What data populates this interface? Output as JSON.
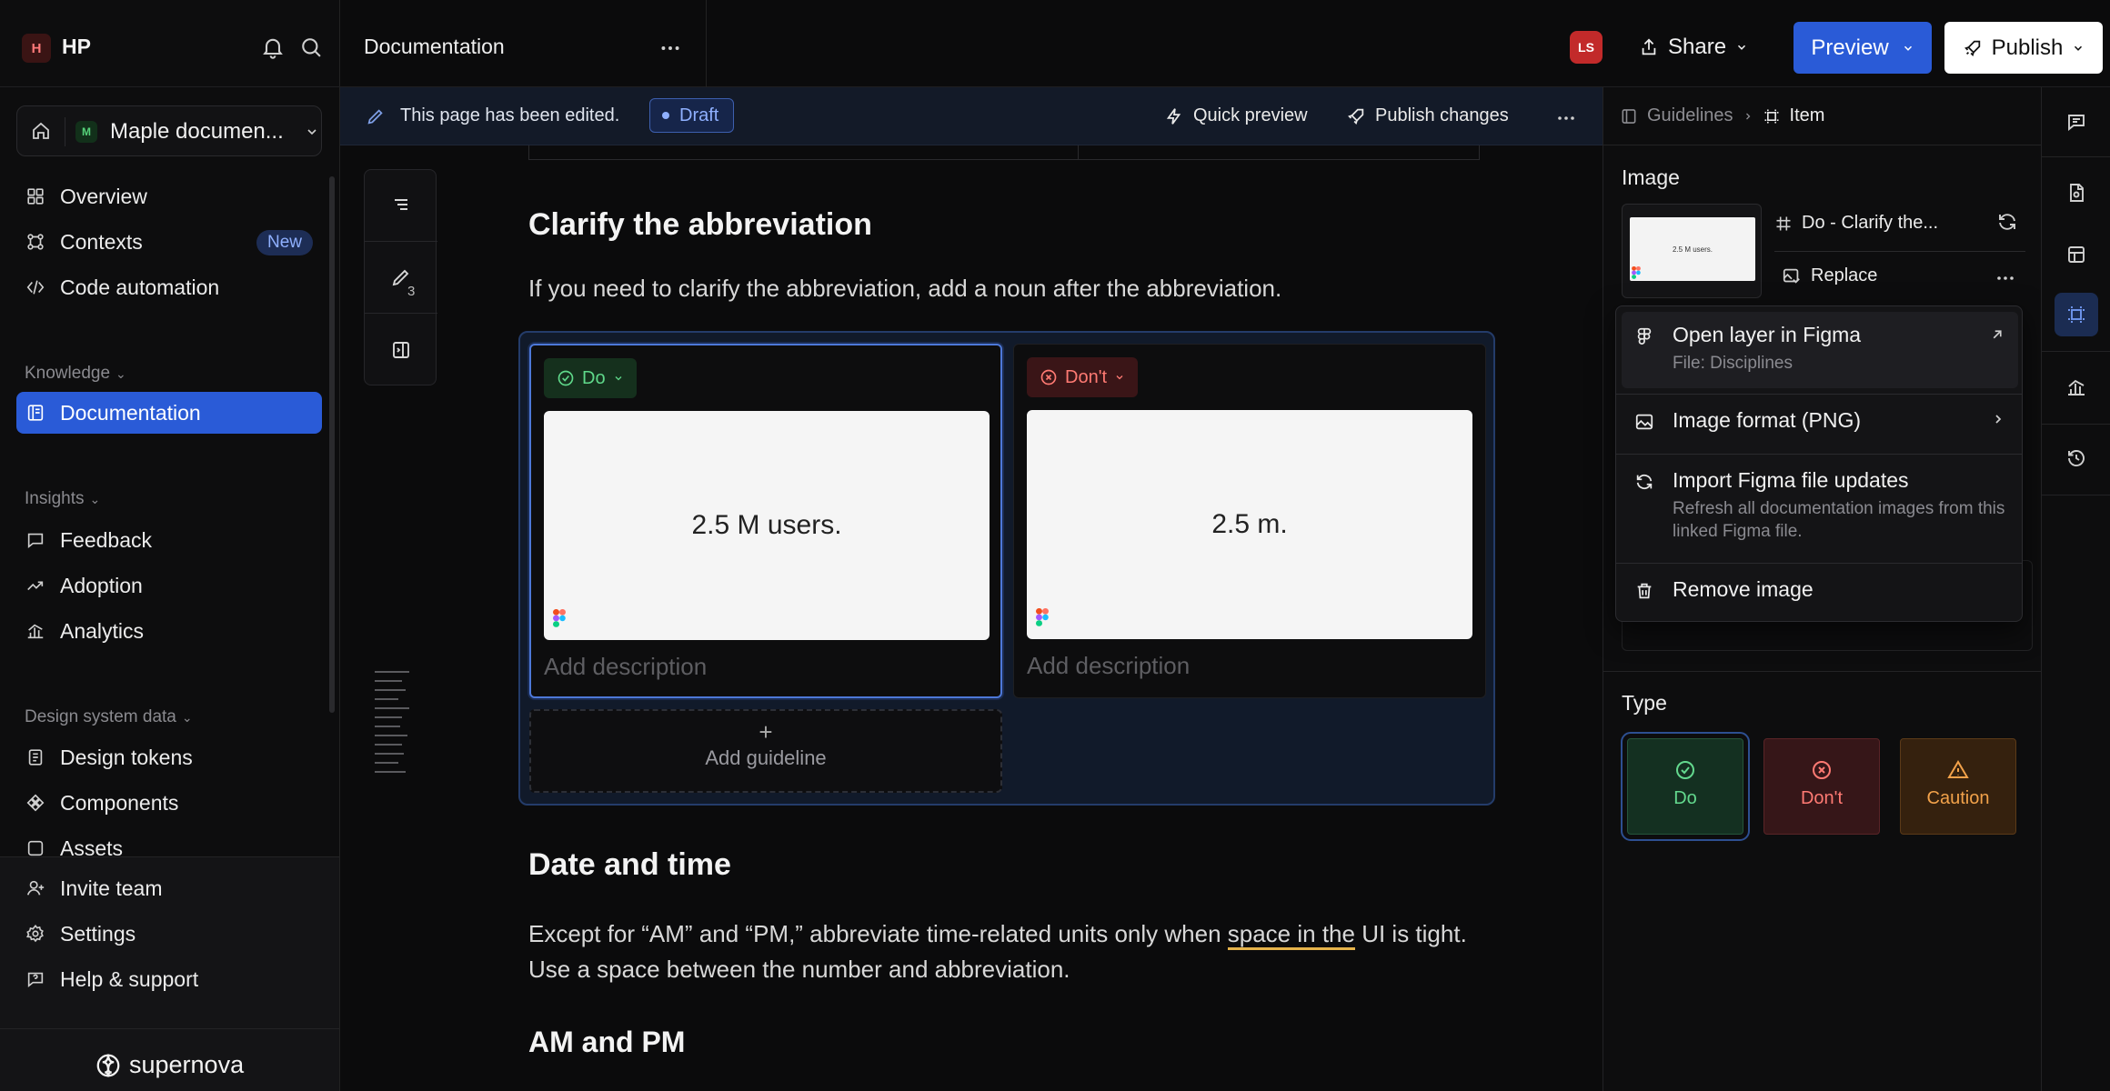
{
  "workspace": {
    "logo_letter": "H",
    "name": "HP"
  },
  "project": {
    "badge": "M",
    "name": "Maple documen..."
  },
  "nav": {
    "overview": "Overview",
    "contexts": "Contexts",
    "contexts_badge": "New",
    "code_automation": "Code automation",
    "knowledge_label": "Knowledge",
    "documentation": "Documentation",
    "insights_label": "Insights",
    "feedback": "Feedback",
    "adoption": "Adoption",
    "analytics": "Analytics",
    "dsd_label": "Design system data",
    "design_tokens": "Design tokens",
    "components": "Components",
    "assets": "Assets",
    "invite_team": "Invite team",
    "settings": "Settings",
    "help_support": "Help & support"
  },
  "brand": {
    "name": "supernova"
  },
  "header": {
    "title": "Documentation",
    "avatar_initials": "LS",
    "share": "Share",
    "preview": "Preview",
    "publish": "Publish"
  },
  "editbar": {
    "message": "This page has been edited.",
    "draft": "Draft",
    "quick_preview": "Quick preview",
    "publish_changes": "Publish changes"
  },
  "toc": {
    "edit_count": "3"
  },
  "content": {
    "h_clarify": "Clarify the abbreviation",
    "p_clarify": "If you need to clarify the abbreviation, add a noun after the abbreviation.",
    "do_tag": "Do",
    "dont_tag": "Don't",
    "do_image_text": "2.5 M users.",
    "dont_image_text": "2.5 m.",
    "do_desc_placeholder": "Add description",
    "dont_desc_placeholder": "Add description",
    "add_guideline": "Add guideline",
    "h_date": "Date and time",
    "p_date_before": "Except for “AM” and “PM,” abbreviate time-related units only when ",
    "p_date_underlined": "space in the",
    "p_date_after": " UI is tight. Use a space between the number and abbreviation.",
    "h_ampm": "AM and PM"
  },
  "panel": {
    "crumb_parent": "Guidelines",
    "crumb_current": "Item",
    "image_label": "Image",
    "thumb_text": "2.5 M users.",
    "frame_name": "Do - Clarify the...",
    "replace": "Replace",
    "type_label": "Type",
    "type_do": "Do",
    "type_dont": "Don't",
    "type_caution": "Caution"
  },
  "menu": {
    "open_layer": "Open layer in Figma",
    "open_layer_sub": "File: Disciplines",
    "image_format": "Image format (PNG)",
    "import_updates": "Import Figma file updates",
    "import_updates_sub": "Refresh all documentation images from this linked Figma file.",
    "remove_image": "Remove image"
  },
  "colors": {
    "accent": "#2a5bd7",
    "do_green": "#5fd88a",
    "dont_red": "#ff7a73",
    "caution_orange": "#f2a24a",
    "avatar_red": "#c22a2a"
  }
}
